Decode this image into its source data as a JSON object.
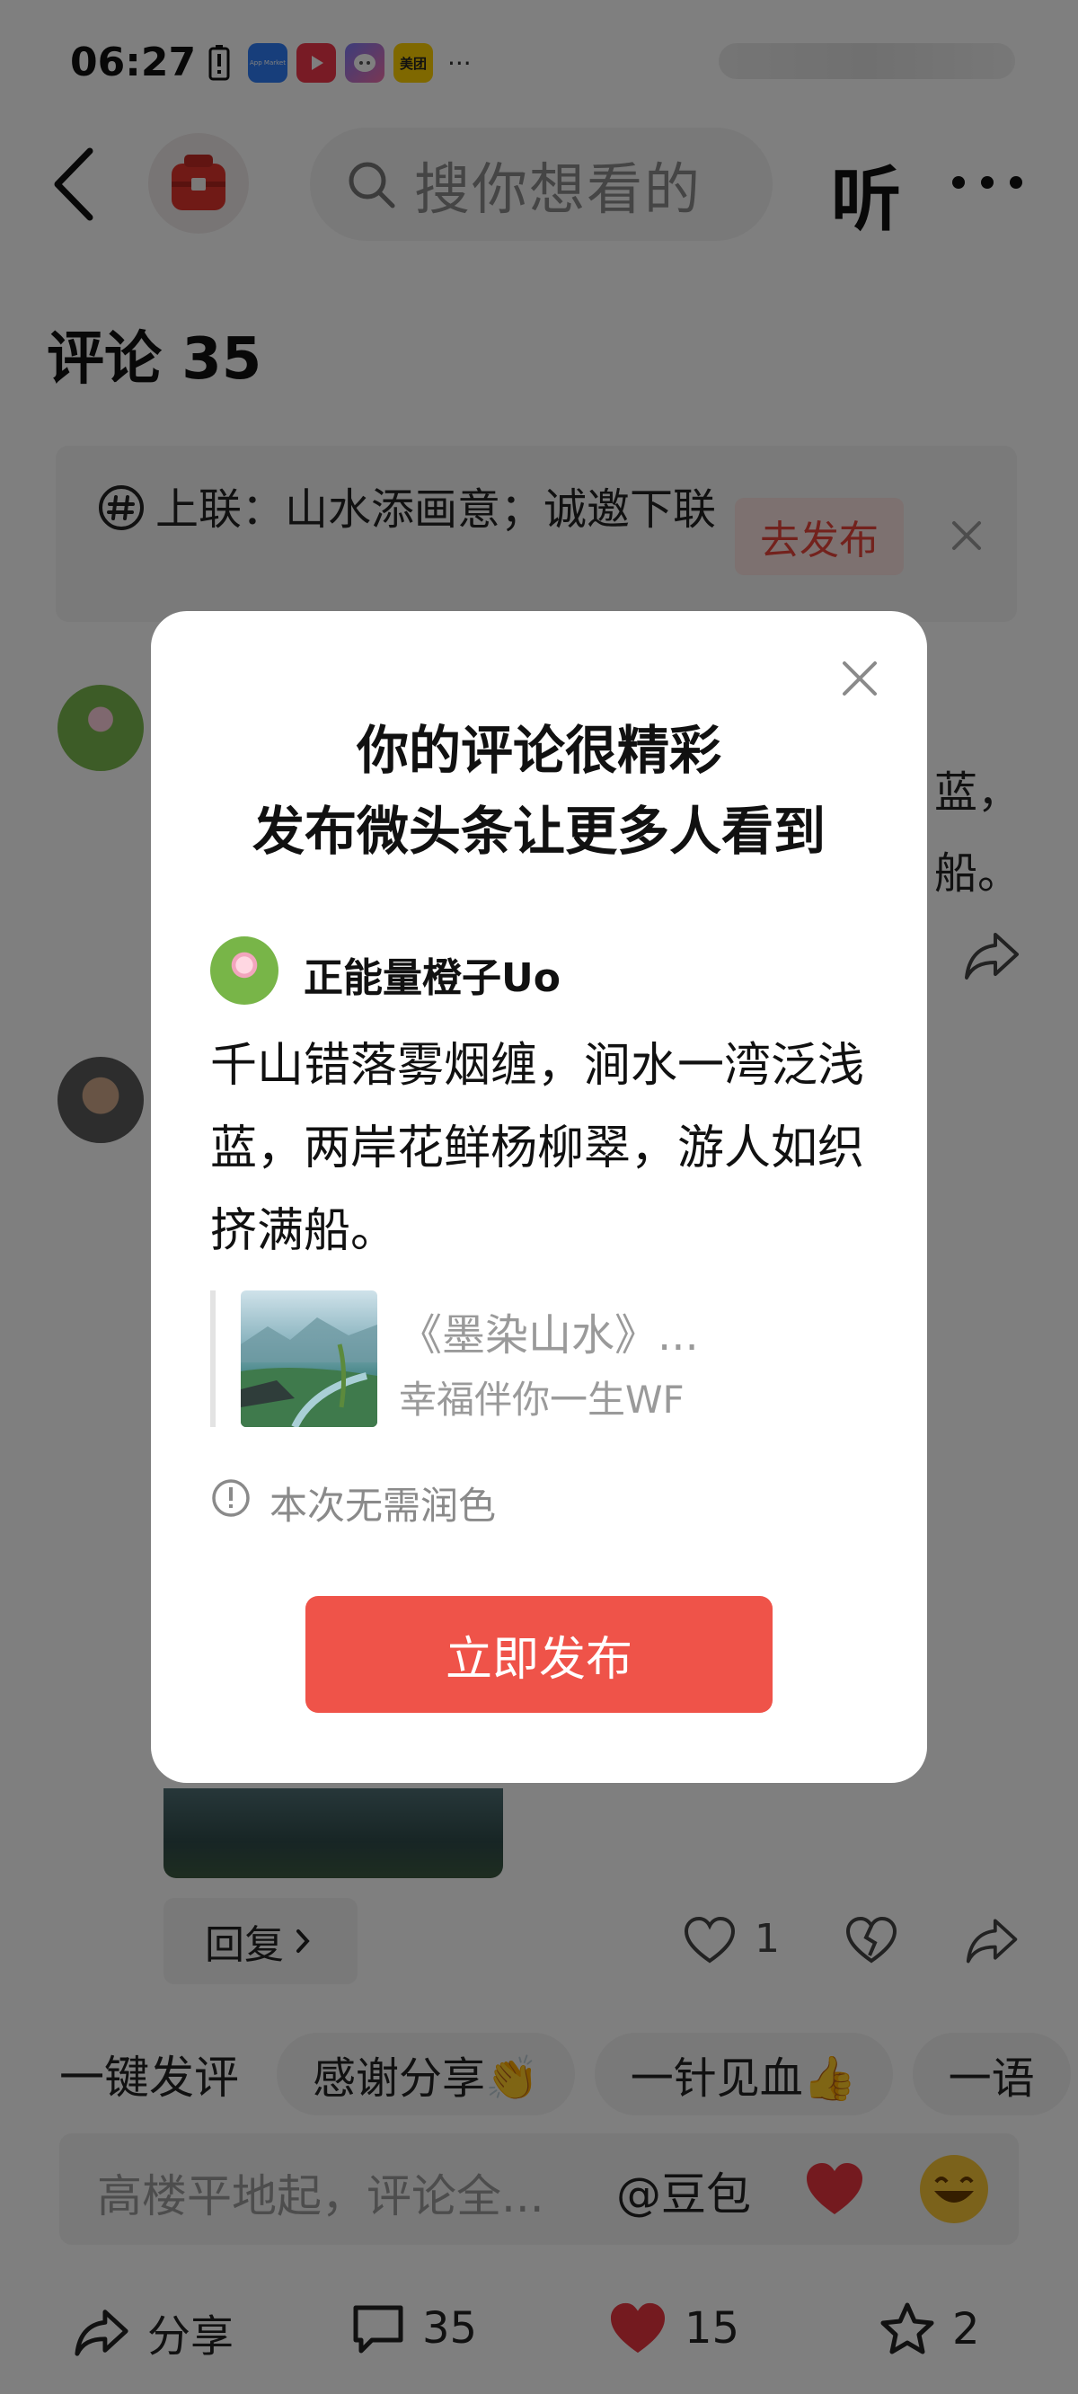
{
  "status_bar": {
    "time": "06:27",
    "icons": [
      "battery-alert-icon",
      "app-market-icon",
      "video-app-icon",
      "chat-app-icon",
      "meituan-icon"
    ],
    "meituan_label": "美团",
    "app_market_label": "App Market",
    "more": "···"
  },
  "header": {
    "search_placeholder": "搜你想看的",
    "listen_label": "听"
  },
  "comments_section": {
    "title": "评论 35",
    "prompt": {
      "text": "上联：山水添画意；诚邀下联",
      "action": "去发布"
    },
    "background_fragments": [
      "蓝，",
      "船。"
    ],
    "reply_label": "回复",
    "like_count": "1"
  },
  "quick_replies": {
    "label": "一键发评",
    "chips": [
      "感谢分享👏",
      "一针见血👍",
      "一语"
    ]
  },
  "comment_input": {
    "placeholder": "高楼平地起，评论全...",
    "at_label": "@豆包",
    "emoji_1": "heart-emoji",
    "emoji_2": "laughing-emoji"
  },
  "bottom_bar": {
    "share_label": "分享",
    "comment_count": "35",
    "like_count": "15",
    "favorite_count": "2",
    "like_color": "#e8353f"
  },
  "modal": {
    "title_line1": "你的评论很精彩",
    "title_line2": "发布微头条让更多人看到",
    "username": "正能量橙子Uo",
    "comment": "千山错落雾烟缠，涧水一湾泛浅蓝，两岸花鲜杨柳翠，游人如织挤满船。",
    "article_title": "《墨染山水》...",
    "article_author": "幸福伴你一生WF",
    "info_text": "本次无需润色",
    "publish_label": "立即发布",
    "accent_color": "#ef5349"
  }
}
